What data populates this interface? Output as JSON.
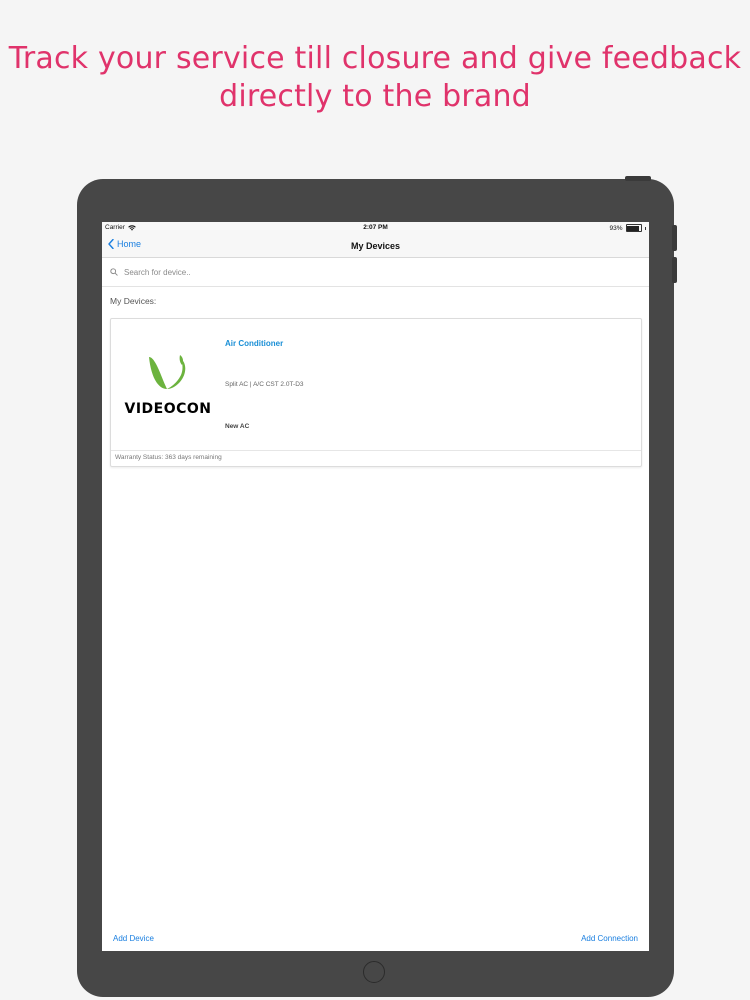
{
  "headline": {
    "line1": "Track your service till closure and give feedback",
    "line2": "directly to the brand"
  },
  "status_bar": {
    "carrier": "Carrier",
    "time": "2:07 PM",
    "battery": "93%"
  },
  "nav": {
    "back_label": "Home",
    "title": "My Devices"
  },
  "search": {
    "placeholder": "Search for device.."
  },
  "section_label": "My Devices:",
  "device": {
    "brand": "VIDEOCON",
    "name": "Air Conditioner",
    "model": "Split AC | A/C CST 2.0T-D3",
    "nickname": "New AC",
    "warranty": "Warranty Status: 363 days remaining"
  },
  "bottom": {
    "add_device": "Add Device",
    "add_connection": "Add Connection"
  },
  "colors": {
    "headline": "#e0336b",
    "accent": "#1a7fe0",
    "brand_green": "#6cb33e",
    "frame": "#474747"
  }
}
